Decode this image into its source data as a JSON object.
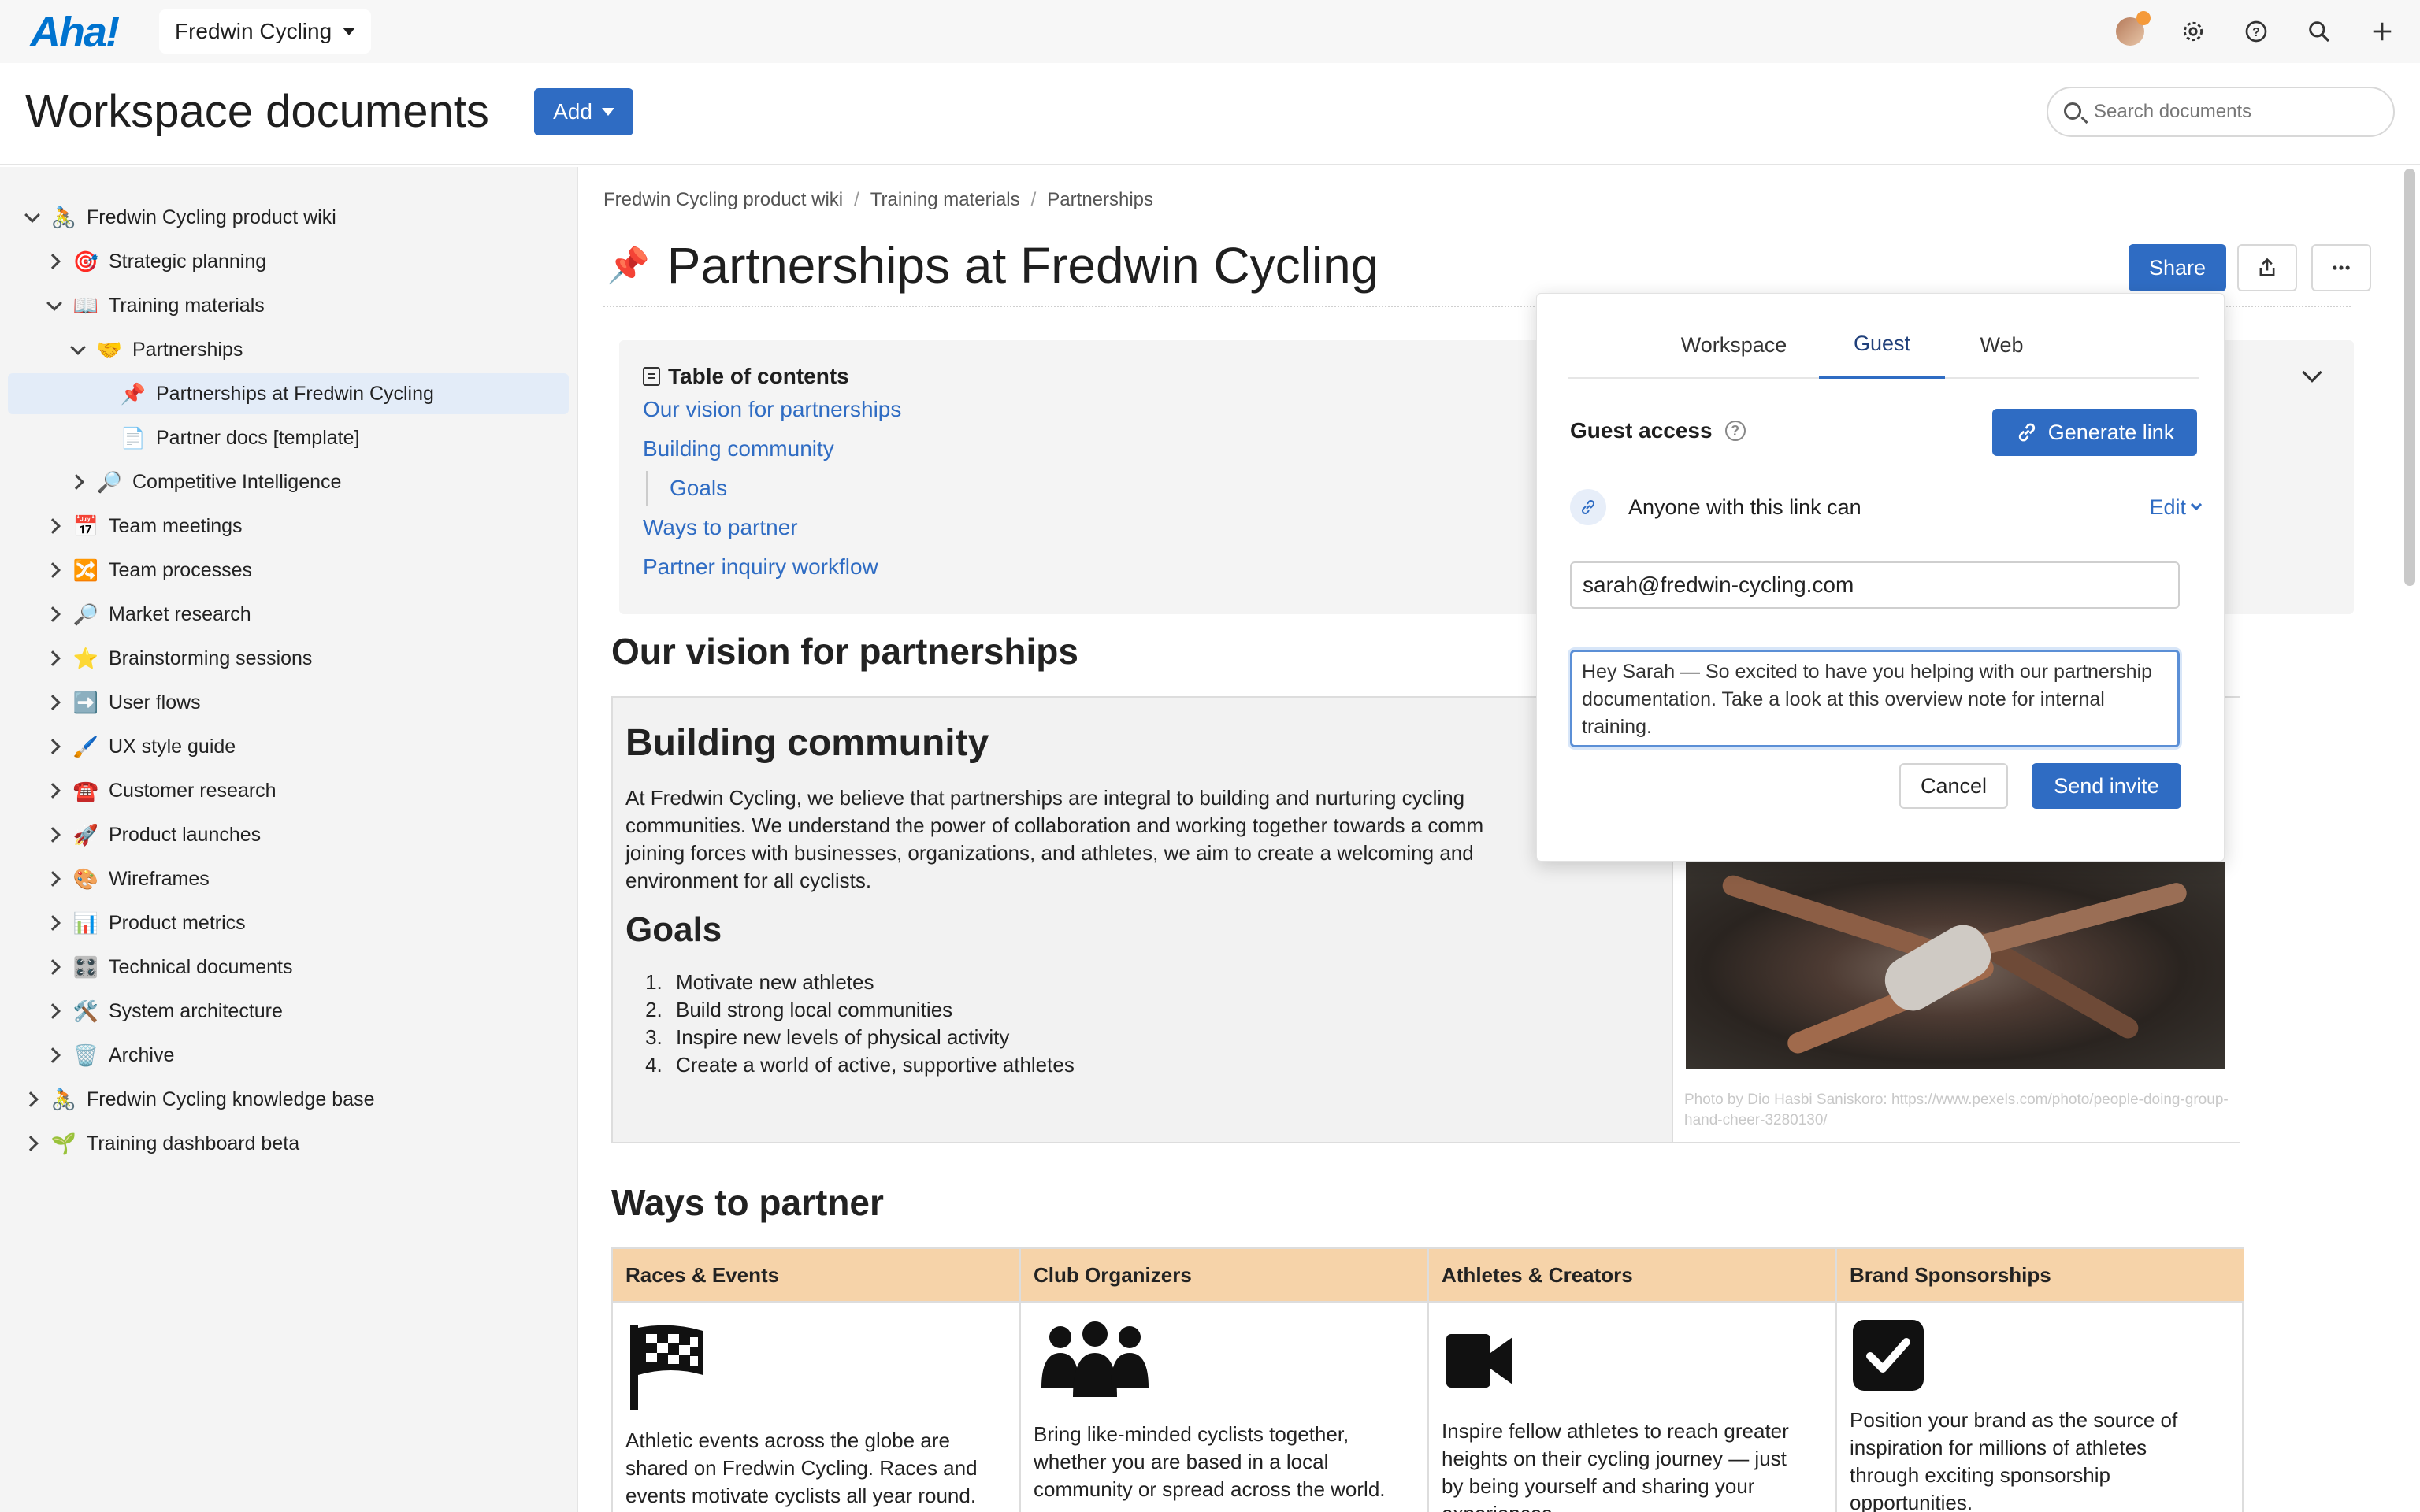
{
  "app": {
    "logo": "Aha!",
    "workspace": "Fredwin Cycling"
  },
  "header": {
    "title": "Workspace documents",
    "add_label": "Add",
    "search_placeholder": "Search documents"
  },
  "sidebar": {
    "items": [
      {
        "label": "Fredwin Cycling product wiki",
        "emoji": "🚴",
        "expanded": true
      },
      {
        "label": "Strategic planning",
        "emoji": "🎯"
      },
      {
        "label": "Training materials",
        "emoji": "📖",
        "expanded": true
      },
      {
        "label": "Partnerships",
        "emoji": "🤝",
        "expanded": true
      },
      {
        "label": "Partnerships at Fredwin Cycling",
        "emoji": "📌",
        "selected": true
      },
      {
        "label": "Partner docs [template]",
        "emoji": "📄"
      },
      {
        "label": "Competitive Intelligence",
        "emoji": "🔎"
      },
      {
        "label": "Team meetings",
        "emoji": "📅"
      },
      {
        "label": "Team processes",
        "emoji": "🔀"
      },
      {
        "label": "Market research",
        "emoji": "🔎"
      },
      {
        "label": "Brainstorming sessions",
        "emoji": "⭐"
      },
      {
        "label": "User flows",
        "emoji": "➡️"
      },
      {
        "label": "UX style guide",
        "emoji": "🖌️"
      },
      {
        "label": "Customer research",
        "emoji": "☎️"
      },
      {
        "label": "Product launches",
        "emoji": "🚀"
      },
      {
        "label": "Wireframes",
        "emoji": "🎨"
      },
      {
        "label": "Product metrics",
        "emoji": "📊"
      },
      {
        "label": "Technical documents",
        "emoji": "🎛️"
      },
      {
        "label": "System architecture",
        "emoji": "🛠️"
      },
      {
        "label": "Archive",
        "emoji": "🗑️"
      },
      {
        "label": "Fredwin Cycling knowledge base",
        "emoji": "🚴"
      },
      {
        "label": "Training dashboard beta",
        "emoji": "🌱"
      }
    ]
  },
  "breadcrumb": [
    "Fredwin Cycling product wiki",
    "Training materials",
    "Partnerships"
  ],
  "document": {
    "title": "Partnerships at Fredwin Cycling",
    "share_label": "Share",
    "toc": {
      "heading": "Table of contents",
      "links": [
        "Our vision for partnerships",
        "Building community",
        "Goals",
        "Ways to partner",
        "Partner inquiry workflow"
      ]
    },
    "vision_heading": "Our vision for partnerships",
    "community_heading": "Building community",
    "community_text": [
      "At Fredwin Cycling, we believe that partnerships are integral to building and nurturing cycling",
      "communities. We understand the power of collaboration and working together towards a comm",
      "joining forces with businesses, organizations, and athletes, we aim to create a welcoming and",
      "environment for all cyclists."
    ],
    "goals_heading": "Goals",
    "goals": [
      "Motivate new athletes",
      "Build strong local communities",
      "Inspire new levels of physical activity",
      "Create a world of active, supportive athletes"
    ],
    "photo_credit": "Photo by Dio Hasbi Saniskoro: https://www.pexels.com/photo/people-doing-group-hand-cheer-3280130/",
    "ways_heading": "Ways to partner",
    "partners": [
      {
        "name": "Races & Events",
        "icon": "checkered-flag-icon",
        "text": [
          "Athletic events across the globe are",
          "shared on Fredwin Cycling. Races and",
          "events motivate cyclists all year round."
        ]
      },
      {
        "name": "Club Organizers",
        "icon": "group-icon",
        "text": [
          "Bring like-minded cyclists together,",
          "whether you are based in a local",
          "community or spread across the world."
        ]
      },
      {
        "name": "Athletes & Creators",
        "icon": "video-camera-icon",
        "text": [
          "Inspire fellow athletes to reach greater",
          "heights on their cycling journey — just",
          "by being yourself and sharing your",
          "experiences."
        ]
      },
      {
        "name": "Brand Sponsorships",
        "icon": "checkbox-icon",
        "text": [
          "Position your brand as the source of",
          "inspiration for millions of athletes",
          "through exciting sponsorship",
          "opportunities."
        ]
      }
    ]
  },
  "share_popover": {
    "tabs": [
      "Workspace",
      "Guest",
      "Web"
    ],
    "active_tab": "Guest",
    "guest_access_label": "Guest access",
    "generate_link_label": "Generate link",
    "link_permission_text": "Anyone with this link can",
    "edit_label": "Edit",
    "email_value": "sarah@fredwin-cycling.com",
    "message_value": "Hey Sarah — So excited to have you helping with our partnership documentation. Take a look at this overview note for internal training.",
    "cancel_label": "Cancel",
    "send_label": "Send invite"
  },
  "colors": {
    "primary": "#2f6cc3",
    "logo": "#0073cf",
    "table_header": "#f6d3a9",
    "selected_row": "#e3ecf8"
  }
}
